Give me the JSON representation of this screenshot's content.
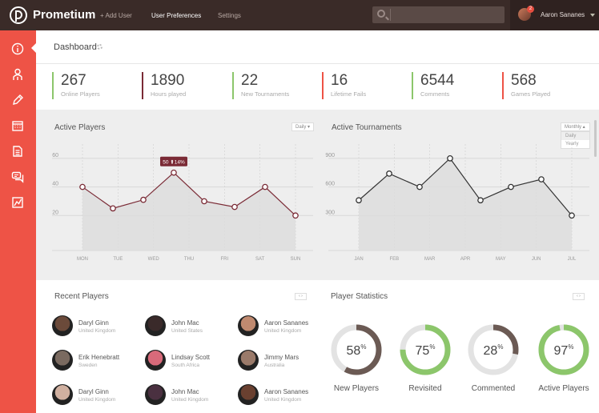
{
  "app": {
    "name": "Prometium"
  },
  "nav": {
    "add_user": "+ Add User",
    "user_preferences": "User Preferences",
    "settings": "Settings"
  },
  "user": {
    "name": "Aaron Sananes",
    "notifications": "2"
  },
  "sidebar": {
    "items": [
      "info-icon",
      "user-icon",
      "pencil-icon",
      "calendar-icon",
      "document-icon",
      "chat-icon",
      "chart-icon"
    ]
  },
  "header": {
    "title": "Dashboard"
  },
  "stats": [
    {
      "value": "267",
      "label": "Online Players",
      "color": "#8cc66b"
    },
    {
      "value": "1890",
      "label": "Hours played",
      "color": "#7a2a35"
    },
    {
      "value": "22",
      "label": "New Tournaments",
      "color": "#8cc66b"
    },
    {
      "value": "16",
      "label": "Lifetime Fails",
      "color": "#ee5346"
    },
    {
      "value": "6544",
      "label": "Comments",
      "color": "#8cc66b"
    },
    {
      "value": "568",
      "label": "Games Played",
      "color": "#ee5346"
    }
  ],
  "active_players": {
    "title": "Active Players",
    "period": "Daily",
    "tooltip": "50 ⬆14%"
  },
  "active_tournaments": {
    "title": "Active Tournaments",
    "period": "Monthly",
    "options": [
      "Daily",
      "Yearly"
    ]
  },
  "chart_data": [
    {
      "type": "line",
      "title": "Active Players",
      "categories": [
        "MON",
        "TUE",
        "WED",
        "THU",
        "FRI",
        "SAT",
        "SUN"
      ],
      "values": [
        40,
        25,
        31,
        50,
        30,
        26,
        40,
        20
      ],
      "x_positions": [
        0,
        1,
        2,
        3,
        4,
        5,
        6,
        6
      ],
      "yticks": [
        "20",
        "40",
        "60"
      ],
      "ylim": [
        0,
        70
      ],
      "color": "#7a2a35"
    },
    {
      "type": "line",
      "title": "Active Tournaments",
      "categories": [
        "JAN",
        "FEB",
        "MAR",
        "APR",
        "MAY",
        "JUN",
        "JUL"
      ],
      "values": [
        460,
        740,
        600,
        900,
        460,
        600,
        680,
        300
      ],
      "yticks": [
        "300",
        "600",
        "900"
      ],
      "ylim": [
        0,
        1050
      ],
      "color": "#333333"
    }
  ],
  "recent_players": {
    "title": "Recent Players",
    "players": [
      {
        "name": "Daryl Ginn",
        "country": "United Kingdom"
      },
      {
        "name": "John Mac",
        "country": "United States"
      },
      {
        "name": "Aaron Sananes",
        "country": "United Kingdom"
      },
      {
        "name": "Erik Henebratt",
        "country": "Sweden"
      },
      {
        "name": "Lindsay Scott",
        "country": "South Africa"
      },
      {
        "name": "Jimmy Mars",
        "country": "Australia"
      },
      {
        "name": "Daryl Ginn",
        "country": "United Kingdom"
      },
      {
        "name": "John Mac",
        "country": "United Kingdom"
      },
      {
        "name": "Aaron Sananes",
        "country": "United Kingdom"
      }
    ]
  },
  "player_statistics": {
    "title": "Player Statistics",
    "gauges": [
      {
        "value": 58,
        "label": "New Players",
        "color": "#6b5a54"
      },
      {
        "value": 75,
        "label": "Revisited",
        "color": "#8cc66b"
      },
      {
        "value": 28,
        "label": "Commented",
        "color": "#6b5a54"
      },
      {
        "value": 97,
        "label": "Active Players",
        "color": "#8cc66b"
      }
    ]
  }
}
